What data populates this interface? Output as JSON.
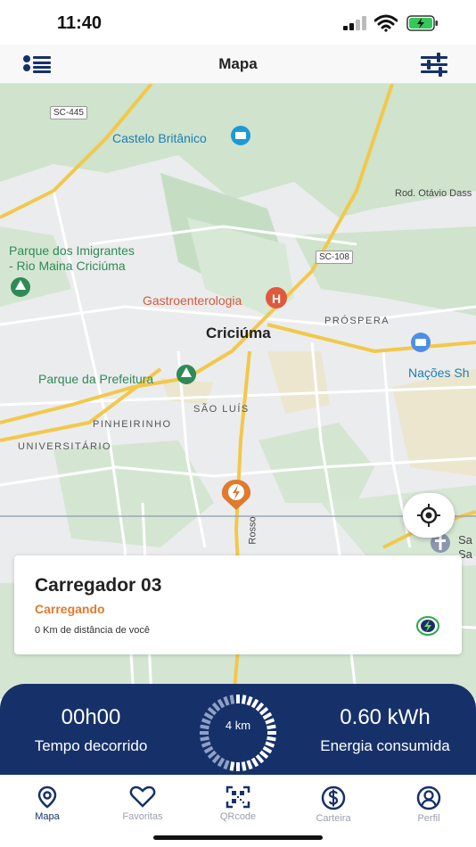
{
  "status_bar": {
    "time": "11:40"
  },
  "nav": {
    "title": "Mapa"
  },
  "map": {
    "labels": {
      "road_sc445": "SC-445",
      "road_sc108": "SC-108",
      "castelo": "Castelo Britânico",
      "rod_otavio": "Rod. Otávio Dass",
      "parque_imigrantes_1": "Parque dos Imigrantes",
      "parque_imigrantes_2": "- Rio Maina Criciúma",
      "gastro": "Gastroenterologia",
      "prospera": "PRÓSPERA",
      "criciuma": "Criciúma",
      "nacoes": "Nações Sh",
      "parque_prefeitura": "Parque da Prefeitura",
      "sao_luis": "SÃO LUÍS",
      "pinheirinho": "PINHEIRINHO",
      "universitario": "UNIVERSITÁRIO",
      "rosso": "Rosso",
      "sa_1": "Sa",
      "sa_2": "Sa"
    }
  },
  "card": {
    "title": "Carregador 03",
    "status": "Carregando",
    "distance": "0 Km de distância de você"
  },
  "charging": {
    "elapsed_value": "00h00",
    "elapsed_caption": "Tempo decorrido",
    "energy_value": "0.60 kWh",
    "energy_caption": "Energia consumida",
    "distance_label": "4 km",
    "progress_fraction": 0.55
  },
  "tabs": [
    {
      "label": "Mapa",
      "icon": "map-pin-icon",
      "active": true
    },
    {
      "label": "Favoritas",
      "icon": "heart-icon",
      "active": false
    },
    {
      "label": "QRcode",
      "icon": "qrcode-icon",
      "active": false
    },
    {
      "label": "Carteira",
      "icon": "dollar-icon",
      "active": false
    },
    {
      "label": "Perfil",
      "icon": "user-icon",
      "active": false
    }
  ],
  "colors": {
    "brand_navy": "#16316a",
    "charging_orange": "#e07a2e",
    "tab_inactive": "#9aa0ad"
  }
}
